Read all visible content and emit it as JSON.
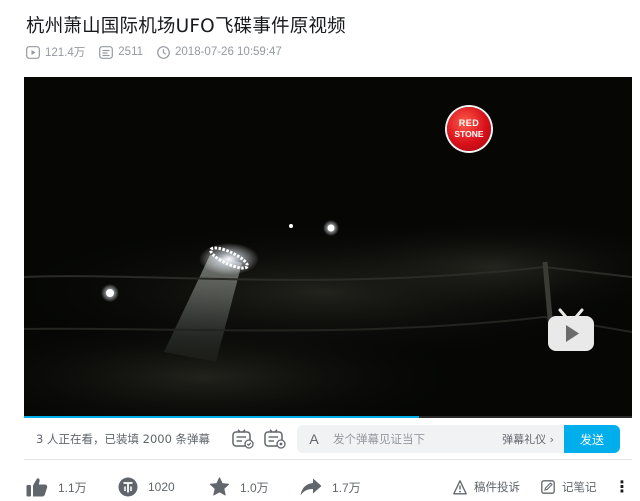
{
  "video": {
    "title": "杭州萧山国际机场UFO飞碟事件原视频",
    "views": "121.4万",
    "danmaku_count": "2511",
    "publish_time": "2018-07-26 10:59:47"
  },
  "player": {
    "watermark_line1": "RED",
    "watermark_line2": "STONE",
    "progress_percent": 65
  },
  "danmaku_bar": {
    "viewers_text": "3 人正在看，已装填 2000 条弹幕",
    "input_icon": "A",
    "input_placeholder": "发个弹幕见证当下",
    "etiquette_label": "弹幕礼仪 ›",
    "send_label": "发送"
  },
  "toolbar": {
    "like_count": "1.1万",
    "coin_count": "1020",
    "favorite_count": "1.0万",
    "share_count": "1.7万",
    "report_label": "稿件投诉",
    "notes_label": "记笔记",
    "more_label": "⋮"
  },
  "colors": {
    "accent": "#00aeec",
    "text_secondary": "#61666d",
    "meta_gray": "#9499a0"
  }
}
